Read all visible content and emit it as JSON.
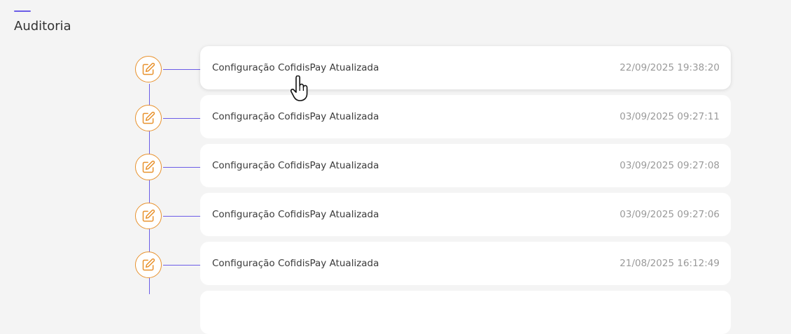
{
  "section": {
    "title": "Auditoria",
    "accent_color": "#6b5ce7"
  },
  "timeline": {
    "node_color": "#e8922e",
    "node_icon": "edit-icon",
    "entries": [
      {
        "title": "Configuração CofidisPay Atualizada",
        "timestamp": "22/09/2025 19:38:20"
      },
      {
        "title": "Configuração CofidisPay Atualizada",
        "timestamp": "03/09/2025 09:27:11"
      },
      {
        "title": "Configuração CofidisPay Atualizada",
        "timestamp": "03/09/2025 09:27:08"
      },
      {
        "title": "Configuração CofidisPay Atualizada",
        "timestamp": "03/09/2025 09:27:06"
      },
      {
        "title": "Configuração CofidisPay Atualizada",
        "timestamp": "21/08/2025 16:12:49"
      }
    ]
  }
}
